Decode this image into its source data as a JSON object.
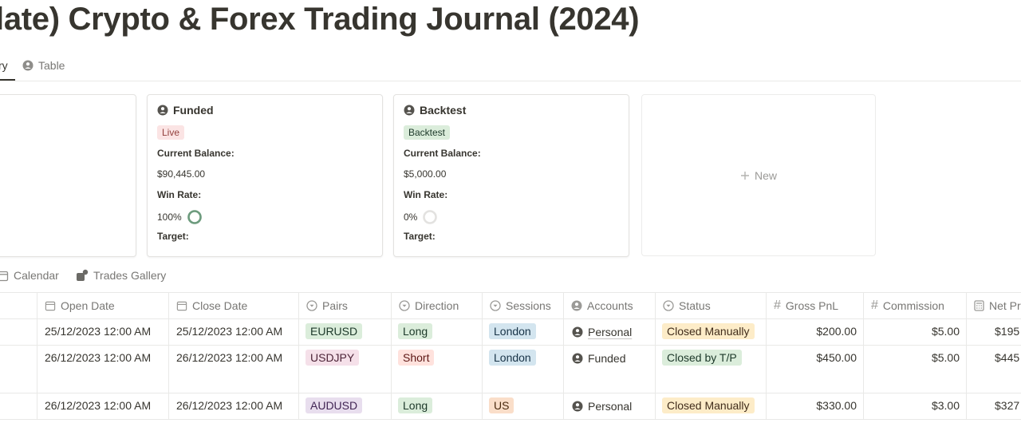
{
  "page": {
    "title": "late) Crypto & Forex Trading Journal (2024)"
  },
  "views_top": {
    "active_tab": "ry",
    "table_tab": "Table"
  },
  "cards": [
    {
      "title": "Funded",
      "tag": "Live",
      "tag_bg": "#fbe4e4",
      "tag_color": "#93403d",
      "balance_label": "Current Balance:",
      "balance": "$90,445.00",
      "winrate_label": "Win Rate:",
      "winrate": "100%",
      "winrate_fraction": 1.0,
      "target_label": "Target:"
    },
    {
      "title": "Backtest",
      "tag": "Backtest",
      "tag_bg": "#dbeddb",
      "tag_color": "#1c3829",
      "balance_label": "Current Balance:",
      "balance": "$5,000.00",
      "winrate_label": "Win Rate:",
      "winrate": "0%",
      "winrate_fraction": 0.0,
      "target_label": "Target:"
    }
  ],
  "new_card": {
    "label": "New"
  },
  "views_bottom": {
    "calendar": "Calendar",
    "gallery": "Trades Gallery"
  },
  "table": {
    "headers": {
      "open_date": "Open Date",
      "close_date": "Close Date",
      "pairs": "Pairs",
      "direction": "Direction",
      "sessions": "Sessions",
      "accounts": "Accounts",
      "status": "Status",
      "gross": "Gross PnL",
      "commission": "Commission",
      "net": "Net Pr"
    },
    "rows": [
      {
        "open": "25/12/2023 12:00 AM",
        "close": "25/12/2023 12:00 AM",
        "pair": "EURUSD",
        "pair_color": "green",
        "direction": "Long",
        "direction_color": "green",
        "session": "London",
        "session_color": "blue",
        "account": "Personal",
        "status": "Closed Manually",
        "status_color": "yellow",
        "gross": "$200.00",
        "commission": "$5.00",
        "net": "$195"
      },
      {
        "open": "26/12/2023 12:00 AM",
        "close": "26/12/2023 12:00 AM",
        "pair": "USDJPY",
        "pair_color": "pink",
        "direction": "Short",
        "direction_color": "red",
        "session": "London",
        "session_color": "blue",
        "account": "Funded",
        "status": "Closed by T/P",
        "status_color": "green",
        "gross": "$450.00",
        "commission": "$5.00",
        "net": "$445"
      },
      {
        "open": "26/12/2023 12:00 AM",
        "close": "26/12/2023 12:00 AM",
        "pair": "AUDUSD",
        "pair_color": "purple",
        "direction": "Long",
        "direction_color": "green",
        "session": "US",
        "session_color": "orange",
        "account": "Personal",
        "status": "Closed Manually",
        "status_color": "yellow",
        "gross": "$330.00",
        "commission": "$3.00",
        "net": "$327"
      }
    ]
  },
  "colors": {
    "green": "#dbeddb",
    "green_text": "#1c3829",
    "pink": "#f5e0e9",
    "pink_text": "#4c2337",
    "purple": "#e8deee",
    "purple_text": "#412454",
    "red": "#ffe2dd",
    "red_text": "#5d1715",
    "blue": "#d3e5ef",
    "blue_text": "#183347",
    "orange": "#fadec9",
    "orange_text": "#49290e",
    "yellow": "#fdecc8",
    "yellow_text": "#402c1b",
    "ring_full": "#6c9b7d",
    "ring_empty": "#e3e2e0"
  }
}
